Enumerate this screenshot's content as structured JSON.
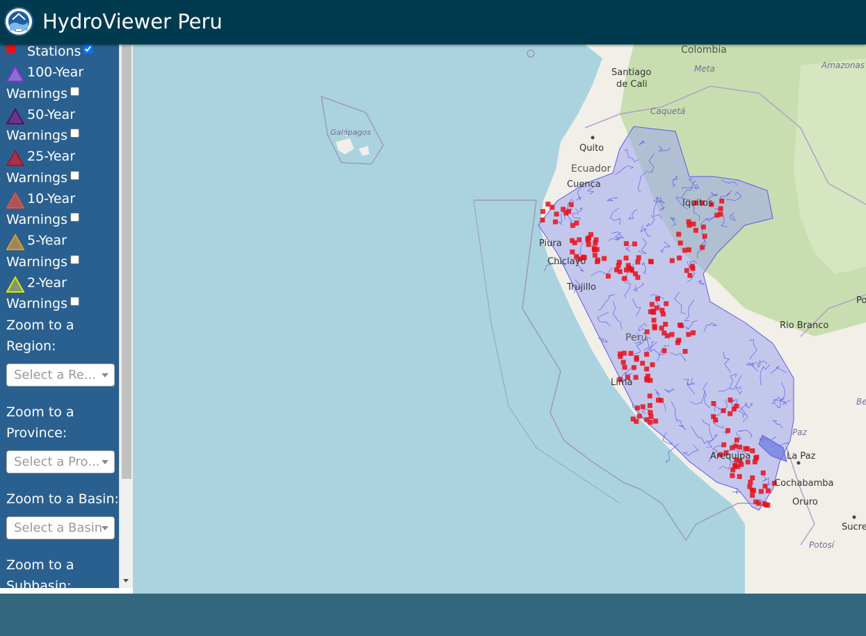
{
  "app": {
    "title": "HydroViewer Peru"
  },
  "legend": {
    "stations": {
      "label": "Stations",
      "checked": true,
      "color": "#e8101a"
    },
    "warnings": [
      {
        "line1": "100-Year",
        "line2": "Warnings",
        "checked": false,
        "color": "#8a2be2"
      },
      {
        "line1": "50-Year",
        "line2": "Warnings",
        "checked": false,
        "color": "#800080"
      },
      {
        "line1": "25-Year",
        "line2": "Warnings",
        "checked": false,
        "color": "#d61a3c"
      },
      {
        "line1": "10-Year",
        "line2": "Warnings",
        "checked": false,
        "color": "#e2543a"
      },
      {
        "line1": "5-Year",
        "line2": "Warnings",
        "checked": false,
        "color": "#e29b2c"
      },
      {
        "line1": "2-Year",
        "line2": "Warnings",
        "checked": false,
        "color": "#e5e500"
      }
    ]
  },
  "zoom": {
    "region": {
      "line1": "Zoom to a",
      "line2": "Region:",
      "placeholder": "Select a Re..."
    },
    "province": {
      "line1": "Zoom to a",
      "line2": "Province:",
      "placeholder": "Select a Pro..."
    },
    "basin": {
      "line1": "Zoom to a Basin:",
      "placeholder": "Select a Basin"
    },
    "subbasin": {
      "line1": "Zoom to a",
      "line2": "Subbasin:"
    }
  },
  "map": {
    "labels": {
      "colombia": "Colombia",
      "santiago": "Santiago",
      "de_cali": "de Cali",
      "meta": "Meta",
      "amazonas": "Amazonas",
      "caqueta": "Caquetá",
      "galapagos": "Galápagos",
      "quito": "Quito",
      "ecuador": "Ecuador",
      "cuenca": "Cuenca",
      "iquitos": "Iquitos",
      "piura": "Piura",
      "chiclayo": "Chiclayo",
      "trujillo": "Trujillo",
      "peru": "Perú",
      "lima": "Lima",
      "rio_branco": "Rio Branco",
      "po": "Po",
      "be": "Be",
      "arequipa": "Arequipa",
      "la_paz": "La Paz",
      "paz": "Paz",
      "cochabamba": "Cochabamba",
      "oruro": "Oruro",
      "sucre": "Sucre",
      "potosi": "Potosí"
    },
    "colors": {
      "water": "#aad3df",
      "land": "#f2efe9",
      "forest": "#c8deb0",
      "river": "#5a5ae8",
      "station": "#e8101a",
      "border": "#9e9ab8"
    }
  }
}
